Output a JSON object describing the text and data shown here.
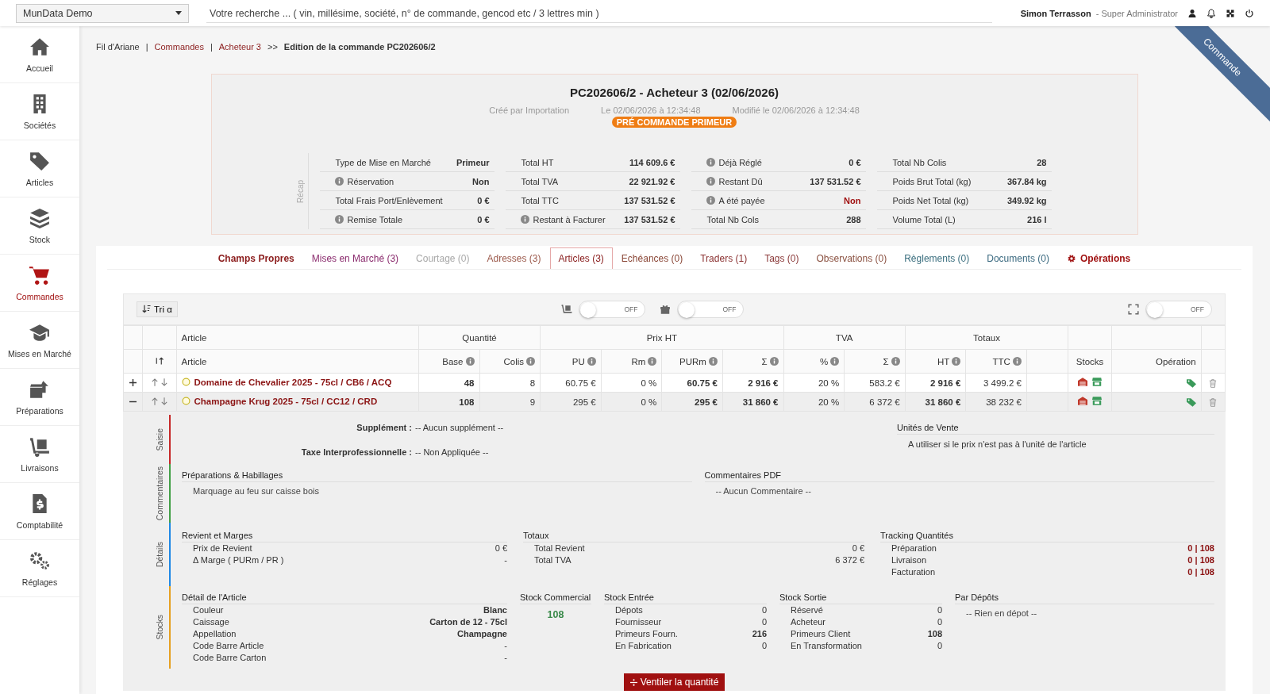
{
  "topbar": {
    "instance": "MunData Demo",
    "search": {
      "placeholder": "Votre recherche ... ( vin, millésime, société, n° de commande, gencod etc / 3 lettres min )"
    },
    "user": {
      "name": "Simon Terrasson",
      "role": "- Super Administrator"
    }
  },
  "sidebar": {
    "items": [
      {
        "label": "Accueil",
        "selected": false
      },
      {
        "label": "Sociétés",
        "selected": false
      },
      {
        "label": "Articles",
        "selected": false
      },
      {
        "label": "Stock",
        "selected": false
      },
      {
        "label": "Commandes",
        "selected": true
      },
      {
        "label": "Mises en Marché",
        "selected": false
      },
      {
        "label": "Préparations",
        "selected": false
      },
      {
        "label": "Livraisons",
        "selected": false
      },
      {
        "label": "Comptabilité",
        "selected": false
      },
      {
        "label": "Réglages",
        "selected": false
      }
    ]
  },
  "breadcrumb": [
    {
      "label": "Fil d'Ariane",
      "kind": "text"
    },
    {
      "label": "|",
      "kind": "sep"
    },
    {
      "label": "Commandes",
      "kind": "link"
    },
    {
      "label": "|",
      "kind": "sep"
    },
    {
      "label": "Acheteur 3",
      "kind": "link"
    },
    {
      "label": ">>",
      "kind": "sep"
    },
    {
      "label": "Edition de la commande PC202606/2",
      "kind": "current"
    }
  ],
  "ribbon": "Commande",
  "recap": {
    "title": "PC202606/2 - Acheteur 3 (02/06/2026)",
    "meta": [
      "Créé par Importation",
      "Le 02/06/2026 à 12:34:48",
      "Modifié le 02/06/2026 à 12:34:48"
    ],
    "badge": "PRÉ COMMANDE PRIMEUR",
    "side_label": "Récap",
    "columns": [
      [
        {
          "label": "Type de Mise en Marché",
          "value": "Primeur",
          "info": false,
          "alert": false
        },
        {
          "label": "Réservation",
          "value": "Non",
          "info": true,
          "alert": false
        },
        {
          "label": "Total Frais Port/Enlèvement",
          "value": "0 €",
          "info": false,
          "alert": false
        },
        {
          "label": "Remise Totale",
          "value": "0 €",
          "info": true,
          "alert": false
        }
      ],
      [
        {
          "label": "Total HT",
          "value": "114 609.6 €",
          "info": false,
          "alert": false
        },
        {
          "label": "Total TVA",
          "value": "22 921.92 €",
          "info": false,
          "alert": false
        },
        {
          "label": "Total TTC",
          "value": "137 531.52 €",
          "info": false,
          "alert": false
        },
        {
          "label": "Restant à Facturer",
          "value": "137 531.52 €",
          "info": true,
          "alert": false
        }
      ],
      [
        {
          "label": "Déjà Réglé",
          "value": "0 €",
          "info": true,
          "alert": false
        },
        {
          "label": "Restant Dû",
          "value": "137 531.52 €",
          "info": true,
          "alert": false
        },
        {
          "label": "A été payée",
          "value": "Non",
          "info": true,
          "alert": true
        },
        {
          "label": "Total Nb Cols",
          "value": "288",
          "info": false,
          "alert": false
        }
      ],
      [
        {
          "label": "Total Nb Colis",
          "value": "28",
          "info": false,
          "alert": false
        },
        {
          "label": "Poids Brut Total (kg)",
          "value": "367.84 kg",
          "info": false,
          "alert": false
        },
        {
          "label": "Poids Net Total (kg)",
          "value": "349.92 kg",
          "info": false,
          "alert": false
        },
        {
          "label": "Volume Total (L)",
          "value": "216 l",
          "info": false,
          "alert": false
        }
      ]
    ]
  },
  "tabs": [
    {
      "label": "Champs Propres",
      "selected": false,
      "kind": "tab",
      "color": "#8b1c1c"
    },
    {
      "label": "Mises en Marché (3)",
      "selected": false,
      "kind": "tab",
      "color": "#8b2c6e"
    },
    {
      "label": "Courtage (0)",
      "selected": false,
      "kind": "tab",
      "color": "#a9a9a9"
    },
    {
      "label": "Adresses (3)",
      "selected": false,
      "kind": "tab",
      "color": "#9c5a4c"
    },
    {
      "label": "Articles (3)",
      "selected": true,
      "kind": "tab",
      "color": "#8b2020"
    },
    {
      "label": "Echéances (0)",
      "selected": false,
      "kind": "tab",
      "color": "#8b4838"
    },
    {
      "label": "Traders (1)",
      "selected": false,
      "kind": "tab",
      "color": "#8b3232"
    },
    {
      "label": "Tags (0)",
      "selected": false,
      "kind": "tab",
      "color": "#8b3a3a"
    },
    {
      "label": "Observations (0)",
      "selected": false,
      "kind": "tab",
      "color": "#8b5242"
    },
    {
      "label": "Règlements (0)",
      "selected": false,
      "kind": "tab",
      "color": "#3b6f7f"
    },
    {
      "label": "Documents (0)",
      "selected": false,
      "kind": "tab",
      "color": "#3b6a80"
    },
    {
      "label": "Opérations",
      "selected": false,
      "kind": "action",
      "color": "#a01212"
    }
  ],
  "toolbar": {
    "sort_button": "Tri α",
    "toggles": [
      {
        "label": "OFF",
        "on": false
      },
      {
        "label": "OFF",
        "on": false
      },
      {
        "label": "OFF",
        "on": false
      }
    ]
  },
  "table": {
    "groups": [
      {
        "label": "Article",
        "columns": [
          {
            "label": "Article",
            "info": false,
            "bold": true
          }
        ]
      },
      {
        "label": "Quantité",
        "columns": [
          {
            "label": "Base",
            "info": true,
            "bold": true
          },
          {
            "label": "Colis",
            "info": true,
            "bold": false
          }
        ]
      },
      {
        "label": "Prix HT",
        "columns": [
          {
            "label": "PU",
            "info": true,
            "bold": false
          },
          {
            "label": "Rm",
            "info": true,
            "bold": false
          },
          {
            "label": "PURm",
            "info": true,
            "bold": true
          },
          {
            "label": "Σ",
            "info": true,
            "bold": true
          }
        ]
      },
      {
        "label": "TVA",
        "columns": [
          {
            "label": "%",
            "info": true,
            "bold": false
          },
          {
            "label": "Σ",
            "info": true,
            "bold": false
          }
        ]
      },
      {
        "label": "Totaux",
        "columns": [
          {
            "label": "HT",
            "info": true,
            "bold": true
          },
          {
            "label": "TTC",
            "info": true,
            "bold": false
          }
        ]
      }
    ],
    "stocks_header": "Stocks",
    "operation_header": "Opération",
    "rows": [
      {
        "expanded": false,
        "cells": [
          "Domaine de Chevalier 2025 - 75cl / CB6 / ACQ",
          "48",
          "8",
          "60.75 €",
          "0 %",
          "60.75 €",
          "2 916 €",
          "20 %",
          "583.2 €",
          "2 916 €",
          "3 499.2 €"
        ]
      },
      {
        "expanded": true,
        "cells": [
          "Champagne Krug 2025 - 75cl / CC12 / CRD",
          "108",
          "9",
          "295 €",
          "0 %",
          "295 €",
          "31 860 €",
          "20 %",
          "6 372 €",
          "31 860 €",
          "38 232 €"
        ]
      }
    ]
  },
  "details": {
    "sections": [
      {
        "label": "Saisie",
        "color": "#c62828"
      },
      {
        "label": "Commentaires",
        "color": "#43a047"
      },
      {
        "label": "Détails",
        "color": "#1e88e5"
      },
      {
        "label": "Stocks",
        "color": "#e6a020"
      }
    ],
    "saisie": {
      "fields": [
        {
          "label": "Supplément :",
          "value": "-- Aucun supplément --"
        },
        {
          "label": "Taxe Interprofessionnelle :",
          "value": "-- Non Appliquée --"
        }
      ],
      "units": {
        "title": "Unités de Vente",
        "text": "A utiliser si le prix n'est pas à l'unité de l'article"
      }
    },
    "comments": [
      {
        "title": "Préparations & Habillages",
        "text": "Marquage au feu sur caisse bois"
      },
      {
        "title": "Commentaires PDF",
        "text": "-- Aucun Commentaire --"
      }
    ],
    "blocks": [
      {
        "title": "Revient et Marges",
        "rows": [
          {
            "label": "Prix de Revient",
            "value": "0 €",
            "kind": "plain"
          },
          {
            "label": "Δ Marge ( PURm / PR )",
            "value": "-",
            "kind": "plain"
          }
        ]
      },
      {
        "title": "Totaux",
        "rows": [
          {
            "label": "Total Revient",
            "value": "0 €",
            "kind": "plain"
          },
          {
            "label": "Total TVA",
            "value": "6 372 €",
            "kind": "plain"
          }
        ]
      },
      {
        "title": "Tracking Quantités",
        "rows": [
          {
            "label": "Préparation",
            "value": "0 | 108",
            "kind": "alert"
          },
          {
            "label": "Livraison",
            "value": "0 | 108",
            "kind": "alert"
          },
          {
            "label": "Facturation",
            "value": "0 | 108",
            "kind": "alert"
          }
        ]
      }
    ],
    "stock": {
      "article": {
        "title": "Détail de l'Article",
        "rows": [
          {
            "label": "Couleur",
            "value": "Blanc",
            "kind": "bold"
          },
          {
            "label": "Caissage",
            "value": "Carton de 12 - 75cl",
            "kind": "bold"
          },
          {
            "label": "Appellation",
            "value": "Champagne",
            "kind": "bold"
          },
          {
            "label": "Code Barre Article",
            "value": "-",
            "kind": "plain"
          },
          {
            "label": "Code Barre Carton",
            "value": "-",
            "kind": "plain"
          }
        ]
      },
      "commercial": {
        "title": "Stock Commercial",
        "value": "108"
      },
      "entree": {
        "title": "Stock Entrée",
        "rows": [
          {
            "label": "Dépots",
            "value": "0",
            "kind": "plain"
          },
          {
            "label": "Fournisseur",
            "value": "0",
            "kind": "plain"
          },
          {
            "label": "Primeurs Fourn.",
            "value": "216",
            "kind": "bold"
          },
          {
            "label": "En Fabrication",
            "value": "0",
            "kind": "plain"
          }
        ]
      },
      "sortie": {
        "title": "Stock Sortie",
        "rows": [
          {
            "label": "Réservé",
            "value": "0",
            "kind": "plain"
          },
          {
            "label": "Acheteur",
            "value": "0",
            "kind": "plain"
          },
          {
            "label": "Primeurs Client",
            "value": "108",
            "kind": "bold"
          },
          {
            "label": "En Transformation",
            "value": "0",
            "kind": "plain"
          }
        ]
      },
      "depots": {
        "title": "Par Dépôts",
        "text": "-- Rien en dépot --"
      }
    },
    "button": "Ventiler la quantité"
  }
}
